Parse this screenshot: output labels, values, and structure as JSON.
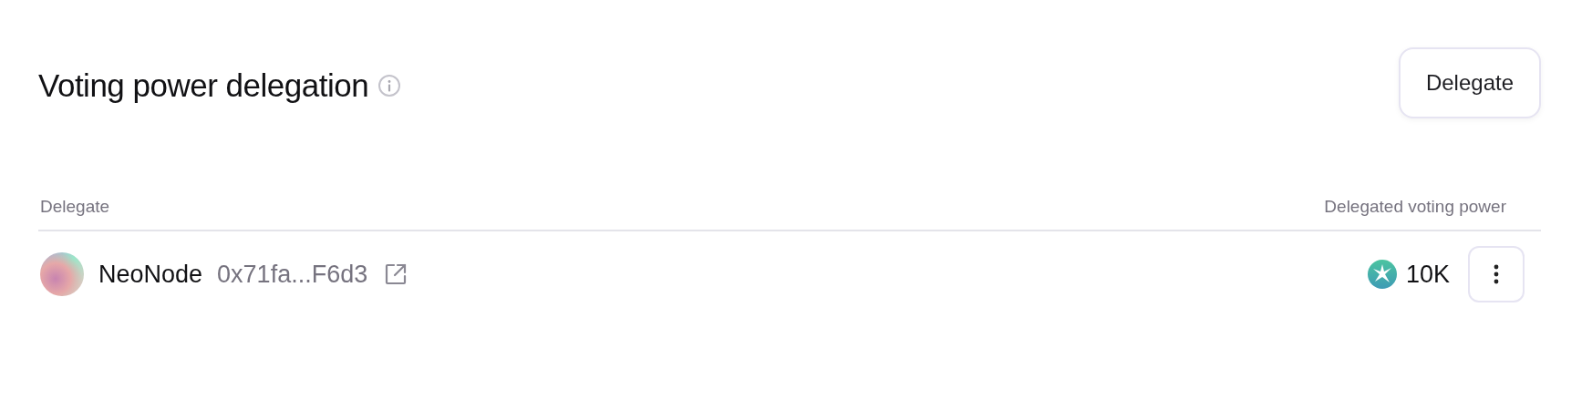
{
  "header": {
    "title": "Voting power delegation",
    "button": "Delegate"
  },
  "table": {
    "columns": [
      "Delegate",
      "Delegated voting power"
    ],
    "rows": [
      {
        "name": "NeoNode",
        "address": "0x71fa...F6d3",
        "power": "10K"
      }
    ]
  }
}
